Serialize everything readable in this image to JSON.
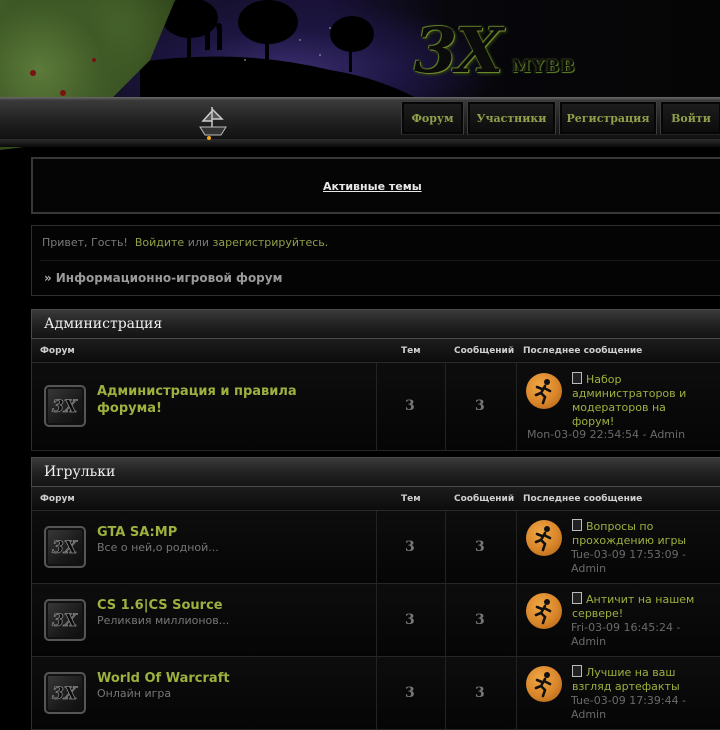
{
  "header": {
    "logo_text": "3X",
    "logo_sub": "MYBB"
  },
  "nav": {
    "items": [
      {
        "label": "Форум"
      },
      {
        "label": "Участники"
      },
      {
        "label": "Регистрация"
      },
      {
        "label": "Войти"
      }
    ]
  },
  "active_topics": {
    "label": "Активные темы"
  },
  "welcome": {
    "greeting": "Привет, Гость!",
    "login": "Войдите",
    "or": "или",
    "register": "зарегистрируйтесь.",
    "breadcrumb": "Информационно-игровой форум"
  },
  "columns": {
    "forum": "Форум",
    "topics": "Тем",
    "posts": "Сообщений",
    "last_post": "Последнее сообщение"
  },
  "categories": [
    {
      "title": "Администрация",
      "forums": [
        {
          "title_line1": "Администрация и правила",
          "title_line2": "форума!",
          "description": "",
          "topics": "3",
          "posts": "3",
          "last_title": "Набор администраторов и модераторов на форум!",
          "last_meta": "Mon-03-09 22:54:54 - Admin"
        }
      ]
    },
    {
      "title": "Игрульки",
      "forums": [
        {
          "title_line1": "GTA SA:MP",
          "title_line2": "",
          "description": "Все о ней,о родной...",
          "topics": "3",
          "posts": "3",
          "last_title": "Вопросы по прохождению игры",
          "last_meta": "Tue-03-09 17:53:09 - Admin"
        },
        {
          "title_line1": "CS 1.6|CS Source",
          "title_line2": "",
          "description": "Реликвия миллионов...",
          "topics": "3",
          "posts": "3",
          "last_title": "Античит на нашем сервере!",
          "last_meta": "Fri-03-09 16:45:24 - Admin"
        },
        {
          "title_line1": "World Of Warcraft",
          "title_line2": "",
          "description": "Онлайн игра",
          "topics": "3",
          "posts": "3",
          "last_title": "Лучшие на ваш взгляд артефакты",
          "last_meta": "Tue-03-09 17:39:44 - Admin"
        }
      ]
    }
  ],
  "colors": {
    "accent": "#9cb13e",
    "background": "#000000",
    "avatar": "#d9852a"
  }
}
